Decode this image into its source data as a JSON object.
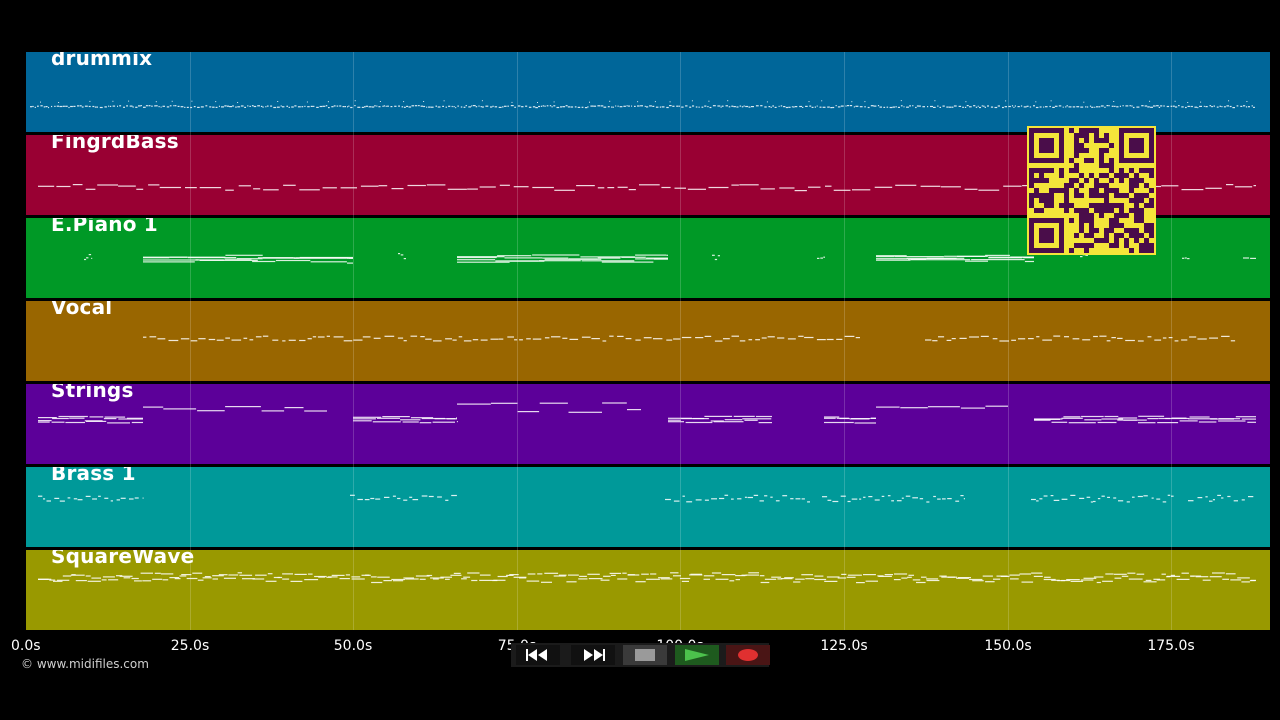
{
  "tracks": [
    {
      "name": "drummix",
      "color": "#006699"
    },
    {
      "name": "FingrdBass",
      "color": "#990033"
    },
    {
      "name": "E.Piano 1",
      "color": "#009926"
    },
    {
      "name": "Vocal",
      "color": "#996600"
    },
    {
      "name": "Strings",
      "color": "#5c0099"
    },
    {
      "name": "Brass 1",
      "color": "#009999"
    },
    {
      "name": "SquareWave",
      "color": "#999900"
    }
  ],
  "timeline": {
    "ticks": [
      "0.0s",
      "25.0s",
      "50.0s",
      "75.0s",
      "100.0s",
      "125.0s",
      "150.0s",
      "175.0s"
    ]
  },
  "footer": {
    "copyright": "© www.midifiles.com"
  },
  "transport": {
    "buttons": [
      {
        "name": "rewind-button",
        "icon": "rewind-icon"
      },
      {
        "name": "fast-forward-button",
        "icon": "fast-forward-icon"
      },
      {
        "name": "stop-button",
        "icon": "stop-icon"
      },
      {
        "name": "play-button",
        "icon": "play-icon"
      },
      {
        "name": "record-button",
        "icon": "record-icon"
      }
    ]
  },
  "overlay": {
    "qr_color": "#f4e53a",
    "qr_dark": "#4a0d4a"
  }
}
